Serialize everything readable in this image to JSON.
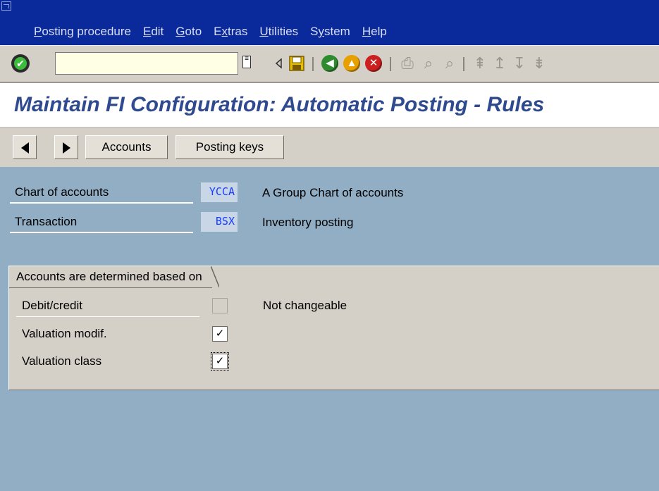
{
  "menu": [
    {
      "label": "Posting procedure",
      "u": "P",
      "rest": "osting procedure"
    },
    {
      "label": "Edit",
      "u": "E",
      "rest": "dit"
    },
    {
      "label": "Goto",
      "u": "G",
      "rest": "oto"
    },
    {
      "label": "Extras",
      "u": "x",
      "pre": "E",
      "rest": "tras"
    },
    {
      "label": "Utilities",
      "u": "U",
      "rest": "tilities"
    },
    {
      "label": "System",
      "u": "y",
      "pre": "S",
      "rest": "stem"
    },
    {
      "label": "Help",
      "u": "H",
      "rest": "elp"
    }
  ],
  "toolbar": {
    "command_value": "",
    "icons": [
      "enter-icon",
      "command-history-icon",
      "back-arrow-icon",
      "save-icon",
      "back-icon",
      "exit-icon",
      "cancel-icon",
      "print-icon",
      "find-icon",
      "find-next-icon",
      "first-page-icon",
      "previous-page-icon",
      "next-page-icon",
      "last-page-icon"
    ],
    "colors": {
      "back": "#2e8b2e",
      "exit": "#e8a000",
      "cancel": "#cc1f1f",
      "save": "#e0c000"
    }
  },
  "page_title": "Maintain FI Configuration: Automatic Posting - Rules",
  "app_toolbar": {
    "accounts_label": "Accounts",
    "posting_keys_label": "Posting keys"
  },
  "fields": {
    "chart_of_accounts": {
      "label": "Chart of accounts",
      "value": "YCCA",
      "text": "A Group Chart of accounts"
    },
    "transaction": {
      "label": "Transaction",
      "value": "BSX",
      "text": "Inventory posting"
    }
  },
  "group": {
    "title": "Accounts are determined based on",
    "rows": [
      {
        "label": "Debit/credit",
        "checked": false,
        "state": "disabled",
        "note": "Not changeable"
      },
      {
        "label": "Valuation modif.",
        "checked": true,
        "state": "enabled",
        "note": ""
      },
      {
        "label": "Valuation class",
        "checked": true,
        "state": "focused",
        "note": ""
      }
    ]
  }
}
